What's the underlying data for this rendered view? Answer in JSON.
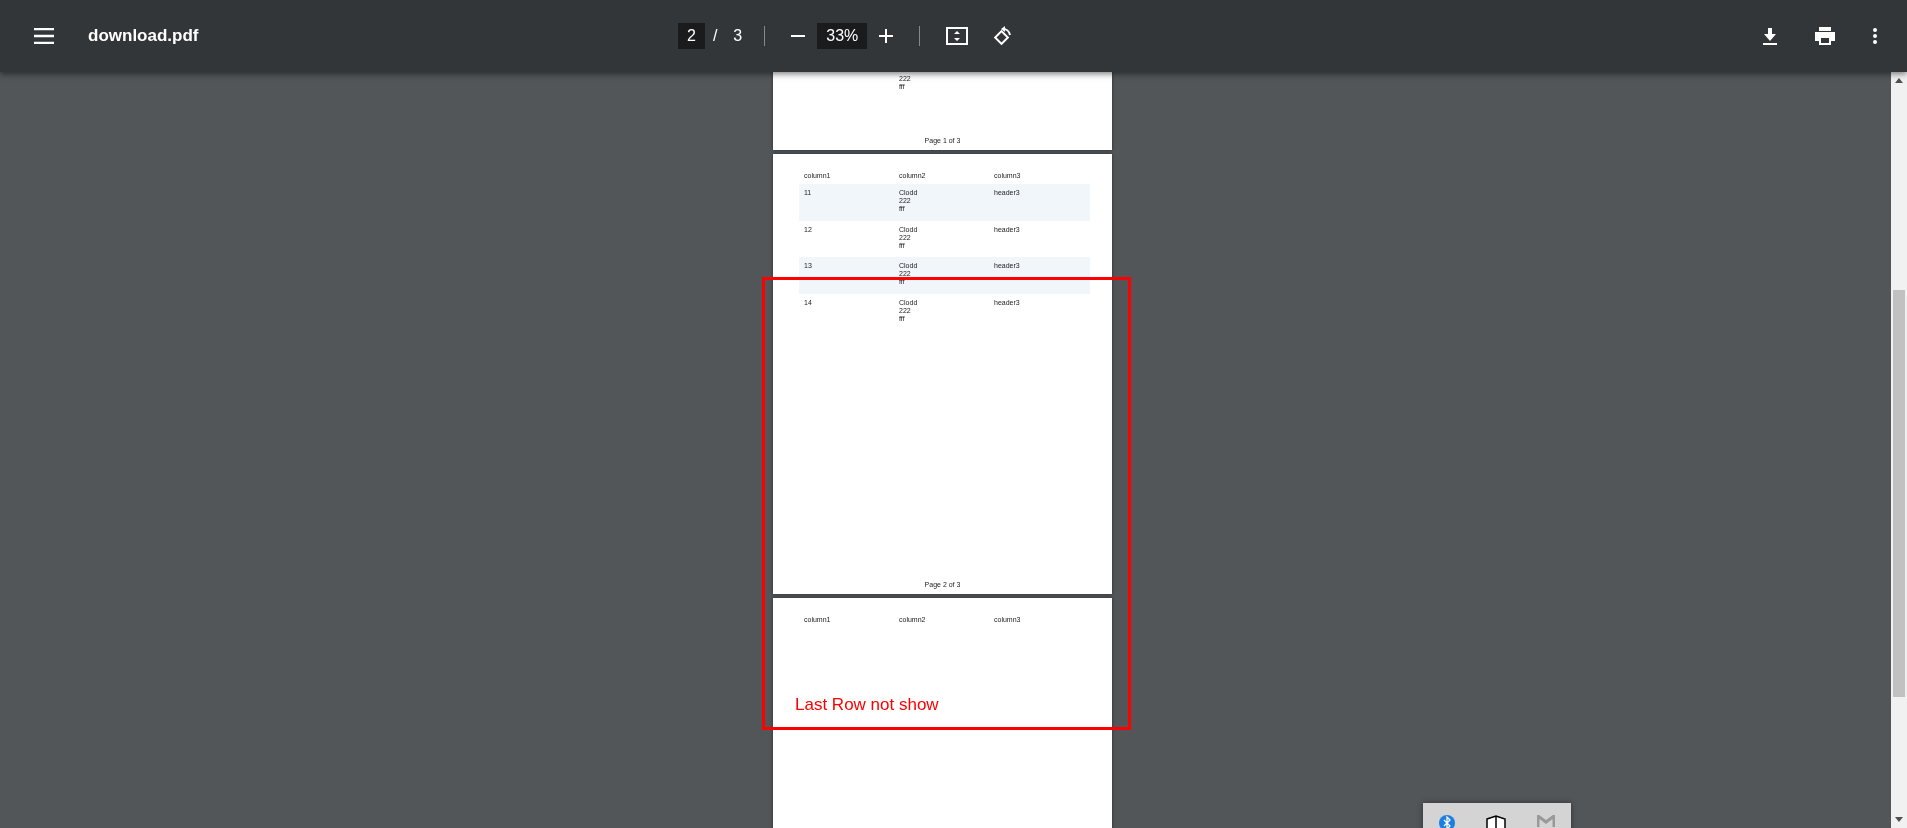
{
  "toolbar": {
    "title": "download.pdf",
    "page_input": "2",
    "page_separator": "/",
    "page_total": "3",
    "zoom": "33%"
  },
  "pages": [
    {
      "rows": [
        {
          "column2": [
            "222",
            "fff"
          ]
        }
      ],
      "footer": "Page 1 of 3"
    },
    {
      "columns": [
        "column1",
        "column2",
        "column3"
      ],
      "rows": [
        {
          "column1": "11",
          "column2": [
            "Clodd",
            "222",
            "fff"
          ],
          "column3": "header3"
        },
        {
          "column1": "12",
          "column2": [
            "Clodd",
            "222",
            "fff"
          ],
          "column3": "header3"
        },
        {
          "column1": "13",
          "column2": [
            "Clodd",
            "222",
            "fff"
          ],
          "column3": "header3"
        },
        {
          "column1": "14",
          "column2": [
            "Clodd",
            "222",
            "fff"
          ],
          "column3": "header3"
        }
      ],
      "footer": "Page 2 of 3"
    },
    {
      "columns": [
        "column1",
        "column2",
        "column3"
      ]
    }
  ],
  "annotation": {
    "text": "Last Row not show"
  }
}
